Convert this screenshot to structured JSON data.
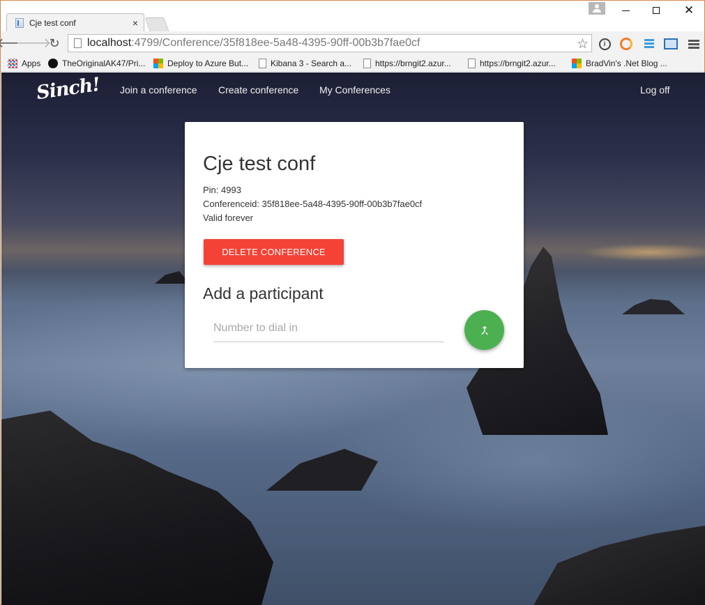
{
  "browser": {
    "tab_title": "Cje test conf",
    "tab_close": "×",
    "url_host": "localhost",
    "url_path": ":4799/Conference/35f818ee-5a48-4395-90ff-00b3b7fae0cf",
    "bookmarks": [
      {
        "label": "Apps",
        "icon": "apps-grid-icon"
      },
      {
        "label": "TheOriginalAK47/Pri...",
        "icon": "github-icon"
      },
      {
        "label": "Deploy to Azure But...",
        "icon": "microsoft-icon"
      },
      {
        "label": "Kibana 3 - Search a...",
        "icon": "page-icon"
      },
      {
        "label": "https://brngit2.azur...",
        "icon": "page-icon"
      },
      {
        "label": "https://brngit2.azur...",
        "icon": "page-icon"
      },
      {
        "label": "BradVin's .Net Blog ...",
        "icon": "microsoft-icon"
      }
    ]
  },
  "navbar": {
    "brand": "Sinch!",
    "links": [
      "Join a conference",
      "Create conference",
      "My Conferences"
    ],
    "logoff": "Log off"
  },
  "conference": {
    "title": "Cje test conf",
    "pin": "Pin: 4993",
    "conference_id": "Conferenceid: 35f818ee-5a48-4395-90ff-00b3b7fae0cf",
    "validity": "Valid forever",
    "delete_label": "Delete conference"
  },
  "participant": {
    "heading": "Add a participant",
    "placeholder": "Number to dial in",
    "value": ""
  },
  "colors": {
    "delete_button": "#f44336",
    "dial_button": "#4caf50"
  }
}
